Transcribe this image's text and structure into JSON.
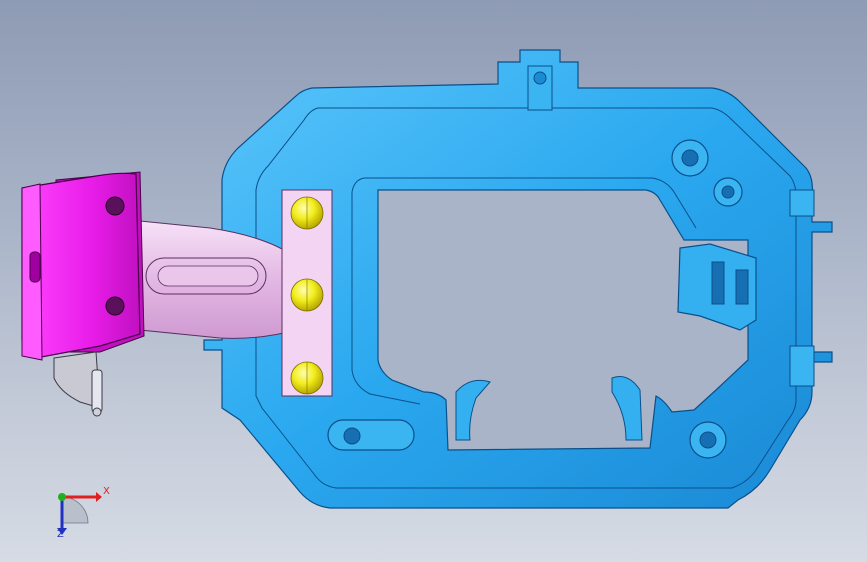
{
  "viewport": {
    "background_top": "#8e9bb4",
    "background_bottom": "#d6dbe4"
  },
  "model": {
    "frame_color": "#2aa8ef",
    "frame_edge_color": "#0b4f8a",
    "bracket_color": "#e81ce8",
    "link_arm_color": "#e9c6ea",
    "pin_color": "#f2ee1e",
    "pin_count": 3
  },
  "triad": {
    "x_label": "X",
    "z_label": "Z",
    "x_color": "#e02020",
    "y_color": "#20b020",
    "z_color": "#2030c0"
  }
}
